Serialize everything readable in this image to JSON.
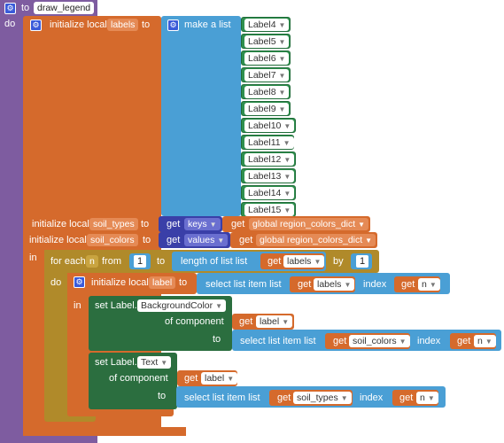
{
  "procedure": {
    "to_kw": "to",
    "name": "draw_legend",
    "do_kw": "do"
  },
  "init_labels": {
    "kw": "initialize local",
    "var": "labels",
    "to_kw": "to",
    "list_kw": "make a list",
    "items": [
      "Label4",
      "Label5",
      "Label6",
      "Label7",
      "Label8",
      "Label9",
      "Label10",
      "Label11",
      "Label12",
      "Label13",
      "Label14",
      "Label15"
    ]
  },
  "init_soil_types": {
    "kw": "initialize local",
    "var": "soil_types",
    "to_kw": "to",
    "get_kw": "get",
    "dict_key": "keys",
    "get2": "get",
    "global": "global region_colors_dict"
  },
  "init_soil_colors": {
    "kw": "initialize local",
    "var": "soil_colors",
    "to_kw": "to",
    "get_kw": "get",
    "dict_key": "values",
    "get2": "get",
    "global": "global region_colors_dict"
  },
  "in_kw": "in",
  "for_each": {
    "kw": "for each",
    "var": "n",
    "from_kw": "from",
    "from_val": "1",
    "to_kw": "to",
    "length_kw": "length of list  list",
    "get_kw": "get",
    "list_var": "labels",
    "by_kw": "by",
    "by_val": "1",
    "do_kw": "do"
  },
  "init_label": {
    "kw": "initialize local",
    "var": "label",
    "to_kw": "to",
    "select_kw": "select list item  list",
    "get_kw": "get",
    "list_var": "labels",
    "index_kw": "index",
    "get_idx": "get",
    "idx_var": "n"
  },
  "in2_kw": "in",
  "set_bg": {
    "kw": "set Label.",
    "prop": "BackgroundColor",
    "of_comp_kw": "of component",
    "get_kw": "get",
    "comp_var": "label",
    "to_kw": "to",
    "select_kw": "select list item  list",
    "get_list": "get",
    "list_var": "soil_colors",
    "index_kw": "index",
    "get_idx": "get",
    "idx_var": "n"
  },
  "set_text": {
    "kw": "set Label.",
    "prop": "Text",
    "of_comp_kw": "of component",
    "get_kw": "get",
    "comp_var": "label",
    "to_kw": "to",
    "select_kw": "select list item  list",
    "get_list": "get",
    "list_var": "soil_types",
    "index_kw": "index",
    "get_idx": "get",
    "idx_var": "n"
  },
  "colors": {
    "procedure": "#7e5ca0",
    "variables": "#d56a2c",
    "lists": "#4a9fd5",
    "components": "#2f8f4e",
    "control": "#b08a2a",
    "dictionaries": "#3a3fa8"
  }
}
